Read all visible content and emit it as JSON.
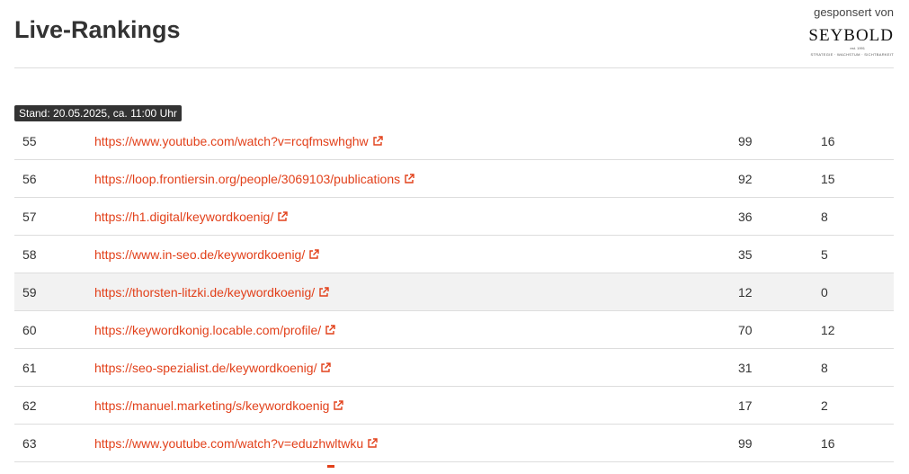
{
  "header": {
    "title": "Live-Rankings",
    "sponsor_text": "gesponsert von",
    "logo_word": "SEYBOLD",
    "logo_est": "est. 1991",
    "logo_tagline": "STRATEGIE · WACHSTUM · SICHTBARKEIT"
  },
  "stand_label": "Stand: 20.05.2025, ca. 11:00 Uhr",
  "colors": {
    "link": "#e2401a",
    "highlight_row": "#f2f2f2",
    "badge_bg": "#333333"
  },
  "rows": [
    {
      "rank": "55",
      "url": "https://www.youtube.com/watch?v=rcqfmswhghw",
      "col_a": "99",
      "col_b": "16",
      "highlight": false
    },
    {
      "rank": "56",
      "url": "https://loop.frontiersin.org/people/3069103/publications",
      "col_a": "92",
      "col_b": "15",
      "highlight": false
    },
    {
      "rank": "57",
      "url": "https://h1.digital/keywordkoenig/",
      "col_a": "36",
      "col_b": "8",
      "highlight": false
    },
    {
      "rank": "58",
      "url": "https://www.in-seo.de/keywordkoenig/",
      "col_a": "35",
      "col_b": "5",
      "highlight": false
    },
    {
      "rank": "59",
      "url": "https://thorsten-litzki.de/keywordkoenig/",
      "col_a": "12",
      "col_b": "0",
      "highlight": true
    },
    {
      "rank": "60",
      "url": "https://keywordkonig.locable.com/profile/",
      "col_a": "70",
      "col_b": "12",
      "highlight": false
    },
    {
      "rank": "61",
      "url": "https://seo-spezialist.de/keywordkoenig/",
      "col_a": "31",
      "col_b": "8",
      "highlight": false
    },
    {
      "rank": "62",
      "url": "https://manuel.marketing/s/keywordkoenig",
      "col_a": "17",
      "col_b": "2",
      "highlight": false
    },
    {
      "rank": "63",
      "url": "https://www.youtube.com/watch?v=eduzhwltwku",
      "col_a": "99",
      "col_b": "16",
      "highlight": false
    }
  ]
}
